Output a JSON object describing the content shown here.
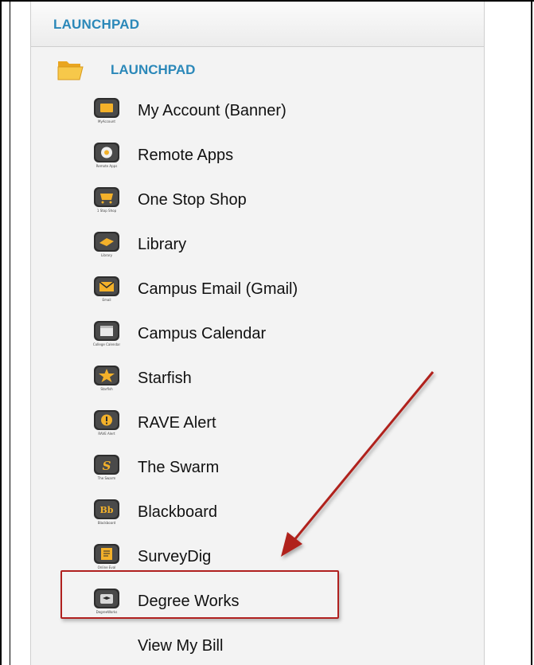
{
  "header": {
    "title": "LAUNCHPAD"
  },
  "folder": {
    "label": "LAUNCHPAD",
    "icon": "folder-open-icon"
  },
  "items": [
    {
      "label": "My Account (Banner)",
      "icon": "my-account-icon",
      "sublabel": "MyAccount"
    },
    {
      "label": "Remote Apps",
      "icon": "remote-apps-icon",
      "sublabel": "Remote Apps"
    },
    {
      "label": "One Stop Shop",
      "icon": "shopping-cart-icon",
      "sublabel": "1 Stop Shop"
    },
    {
      "label": "Library",
      "icon": "library-book-icon",
      "sublabel": "Library"
    },
    {
      "label": "Campus Email (Gmail)",
      "icon": "email-envelope-icon",
      "sublabel": "Email"
    },
    {
      "label": "Campus Calendar",
      "icon": "calendar-icon",
      "sublabel": "College Calendar"
    },
    {
      "label": "Starfish",
      "icon": "starfish-icon",
      "sublabel": "Starfish"
    },
    {
      "label": "RAVE Alert",
      "icon": "alert-icon",
      "sublabel": "RAVE Alert"
    },
    {
      "label": "The Swarm",
      "icon": "swarm-icon",
      "sublabel": "The Swarm"
    },
    {
      "label": "Blackboard",
      "icon": "blackboard-icon",
      "sublabel": "Blackboard"
    },
    {
      "label": "SurveyDig",
      "icon": "survey-icon",
      "sublabel": "Online Eval"
    },
    {
      "label": "Degree Works",
      "icon": "degree-works-icon",
      "sublabel": "DegreeWorks"
    },
    {
      "label": "View My Bill",
      "icon": "",
      "sublabel": ""
    }
  ],
  "annotation": {
    "highlighted_item": "Degree Works",
    "arrow_color": "#b0201f"
  }
}
